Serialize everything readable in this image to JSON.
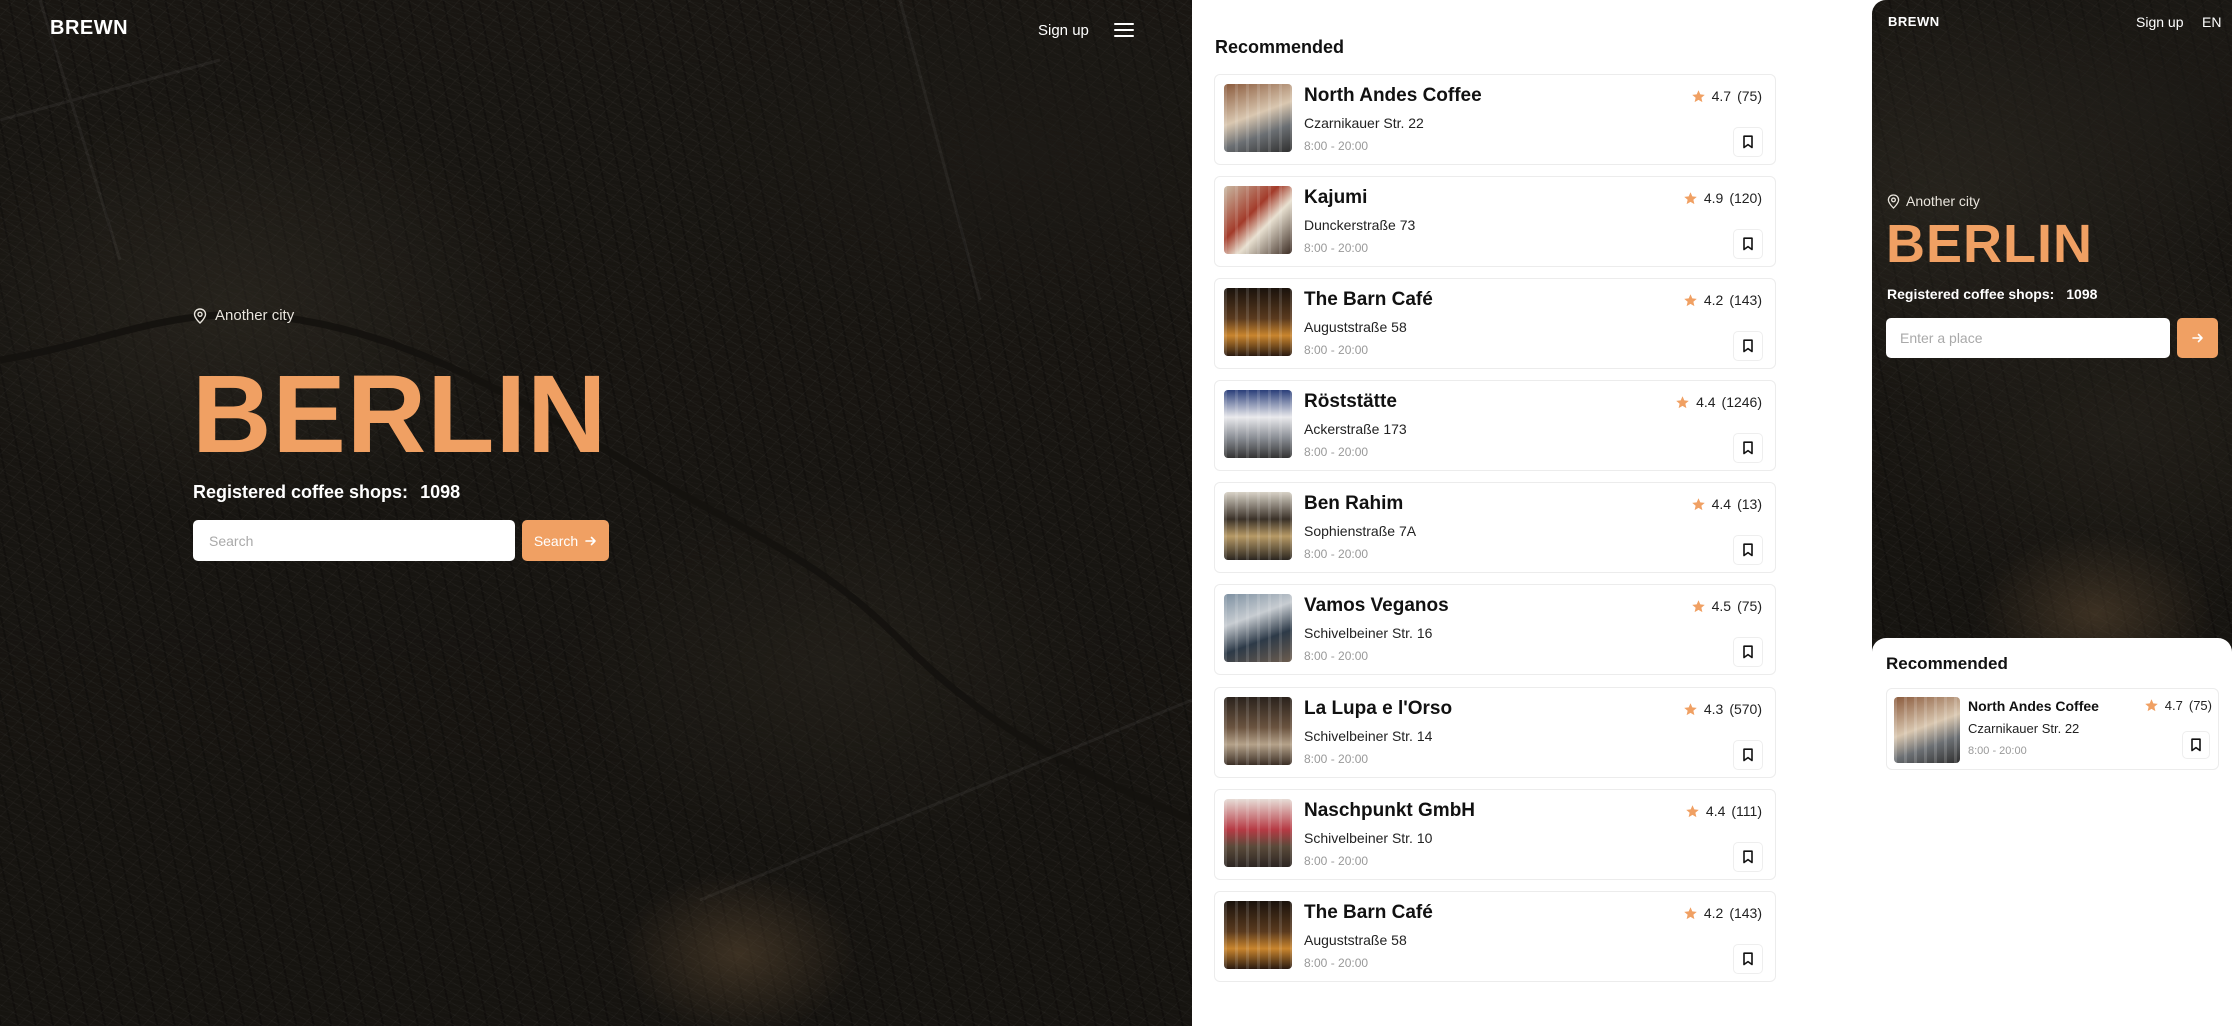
{
  "brand": "BREWN",
  "hero": {
    "signup": "Sign up",
    "another_city": "Another city",
    "city": "BERLIN",
    "count_label": "Registered coffee shops:",
    "count_value": "1098",
    "search_placeholder": "Search",
    "search_button": "Search"
  },
  "recommended": {
    "title": "Recommended",
    "items": [
      {
        "name": "North Andes Coffee",
        "rating": "4.7",
        "reviews": "(75)",
        "address": "Czarnikauer Str. 22",
        "hours": "8:00 - 20:00"
      },
      {
        "name": "Kajumi",
        "rating": "4.9",
        "reviews": "(120)",
        "address": "Dunckerstraße 73",
        "hours": "8:00 - 20:00"
      },
      {
        "name": "The Barn Café",
        "rating": "4.2",
        "reviews": "(143)",
        "address": "Auguststraße 58",
        "hours": "8:00 - 20:00"
      },
      {
        "name": "Röststätte",
        "rating": "4.4",
        "reviews": "(1246)",
        "address": "Ackerstraße 173",
        "hours": "8:00 - 20:00"
      },
      {
        "name": "Ben Rahim",
        "rating": "4.4",
        "reviews": "(13)",
        "address": "Sophienstraße 7A",
        "hours": "8:00 - 20:00"
      },
      {
        "name": "Vamos Veganos",
        "rating": "4.5",
        "reviews": "(75)",
        "address": "Schivelbeiner Str. 16",
        "hours": "8:00 - 20:00"
      },
      {
        "name": "La Lupa e l'Orso",
        "rating": "4.3",
        "reviews": "(570)",
        "address": "Schivelbeiner Str. 14",
        "hours": "8:00 - 20:00"
      },
      {
        "name": "Naschpunkt GmbH",
        "rating": "4.4",
        "reviews": "(111)",
        "address": "Schivelbeiner Str. 10",
        "hours": "8:00 - 20:00"
      },
      {
        "name": "The Barn Café",
        "rating": "4.2",
        "reviews": "(143)",
        "address": "Auguststraße 58",
        "hours": "8:00 - 20:00"
      }
    ]
  },
  "mobile": {
    "signup": "Sign up",
    "lang": "EN",
    "another_city": "Another city",
    "city": "BERLIN",
    "count_label": "Registered coffee shops:",
    "count_value": "1098",
    "search_placeholder": "Enter a place",
    "rec_title": "Recommended",
    "item": {
      "name": "North Andes Coffee",
      "rating": "4.7",
      "reviews": "(75)",
      "address": "Czarnikauer Str. 22",
      "hours": "8:00 - 20:00"
    }
  },
  "colors": {
    "accent": "#f0a063",
    "map_dark": "#1d1a15",
    "text_dark": "#111111",
    "muted": "#999999"
  },
  "icons": [
    "location-pin-icon",
    "menu-icon",
    "arrow-right-icon",
    "star-icon",
    "bookmark-icon"
  ]
}
